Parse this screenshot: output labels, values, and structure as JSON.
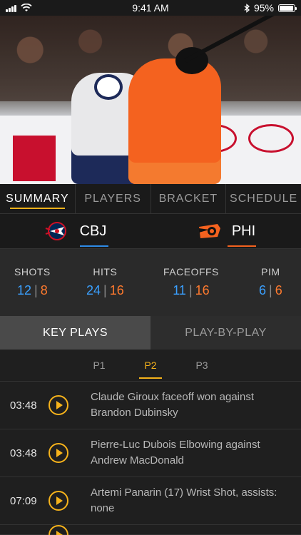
{
  "status_bar": {
    "time": "9:41 AM",
    "battery": "95%",
    "battery_level": 0.95
  },
  "tabs": [
    {
      "label": "SUMMARY",
      "active": true
    },
    {
      "label": "PLAYERS",
      "active": false
    },
    {
      "label": "BRACKET",
      "active": false
    },
    {
      "label": "SCHEDULE",
      "active": false
    }
  ],
  "teams": {
    "home": {
      "abbr": "CBJ",
      "color": "#2e8be6"
    },
    "away": {
      "abbr": "PHI",
      "color": "#f4621f"
    }
  },
  "stats": [
    {
      "label": "SHOTS",
      "home": "12",
      "away": "8"
    },
    {
      "label": "HITS",
      "home": "24",
      "away": "16"
    },
    {
      "label": "FACEOFFS",
      "home": "11",
      "away": "16"
    },
    {
      "label": "PIM",
      "home": "6",
      "away": "6"
    }
  ],
  "segment": {
    "key_plays": "KEY PLAYS",
    "play_by_play": "PLAY-BY-PLAY"
  },
  "periods": [
    {
      "label": "P1",
      "active": false
    },
    {
      "label": "P2",
      "active": true
    },
    {
      "label": "P3",
      "active": false
    }
  ],
  "plays": [
    {
      "time": "03:48",
      "description": "Claude Giroux faceoff won against Brandon Dubinsky"
    },
    {
      "time": "03:48",
      "description": "Pierre-Luc Dubois Elbowing against Andrew MacDonald"
    },
    {
      "time": "07:09",
      "description": "Artemi Panarin (17) Wrist Shot, assists: none"
    }
  ],
  "colors": {
    "accent": "#f5b21b",
    "home": "#3aa0ff",
    "away": "#ff7a2e"
  }
}
